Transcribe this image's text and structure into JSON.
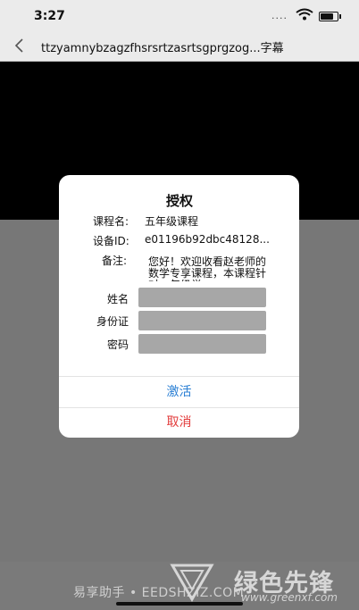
{
  "status_bar": {
    "time": "3:27",
    "signal_text": "....",
    "icons": [
      "wifi-icon",
      "battery-icon"
    ]
  },
  "nav": {
    "back_icon": "chevron-left-icon",
    "title": "ttzyamnybzagzfhsrsrtzasrtsgprgzog...字幕"
  },
  "dialog": {
    "title": "授权",
    "course_label": "课程名:",
    "course_value": "五年级课程",
    "device_label": "设备ID:",
    "device_value": "e01196b92dbc48128...",
    "note_label": "备注:",
    "note_text": "您好！欢迎收看赵老师的数学专享课程，本课程针对一年级学",
    "name_label": "姓名",
    "name_value": "",
    "id_label": "身份证",
    "id_value": "",
    "password_label": "密码",
    "password_value": "",
    "activate_label": "激活",
    "cancel_label": "取消"
  },
  "watermark": {
    "text": "易享助手 • EEDSHZIZ.COM",
    "brand": "绿色先锋",
    "url": "www.greenxf.com"
  },
  "colors": {
    "activate": "#2a7fd4",
    "cancel": "#e23b3b",
    "overlay": "#7f7f7f"
  }
}
